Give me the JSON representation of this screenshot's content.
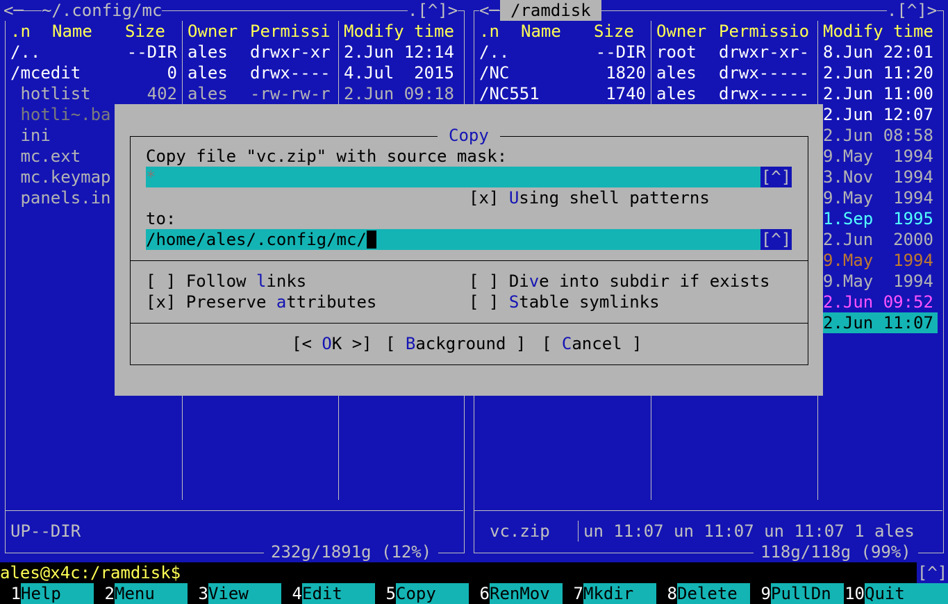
{
  "left_panel": {
    "title": "~/.config/mc",
    "corner_left": "<",
    "corner_right": ".[^]>",
    "headers": [
      ".n",
      "Name",
      "Size",
      "Owner",
      "Permissi",
      "Modify time"
    ],
    "rows": [
      {
        "name": "/..",
        "size": "--DIR",
        "owner": "ales",
        "perm": "drwxr-xr",
        "time": "2.Jun 12:14"
      },
      {
        "name": "/mcedit",
        "size": "0",
        "owner": "ales",
        "perm": "drwx----",
        "time": "4.Jul  2015"
      },
      {
        "name": " hotlist",
        "size": "402",
        "owner": "ales",
        "perm": "-rw-rw-r",
        "time": "2.Jun 09:18"
      },
      {
        "name": " hotli~.ba"
      },
      {
        "name": " ini"
      },
      {
        "name": " mc.ext"
      },
      {
        "name": " mc.keymap"
      },
      {
        "name": " panels.in"
      }
    ],
    "status": "UP--DIR",
    "disk": "232g/1891g (12%)"
  },
  "right_panel": {
    "title": "/ramdisk",
    "corner_left": "<",
    "corner_right": ".[^]>",
    "headers": [
      ".n",
      "Name",
      "Size",
      "Owner",
      "Permissio",
      "Modify time"
    ],
    "rows": [
      {
        "name": "/..",
        "size": "--DIR",
        "owner": "root",
        "perm": "drwxr-xr-",
        "time": "8.Jun 22:01"
      },
      {
        "name": "/NC",
        "size": "1820",
        "owner": "ales",
        "perm": "drwx-----",
        "time": "2.Jun 11:20"
      },
      {
        "name": "/NC551",
        "size": "1740",
        "owner": "ales",
        "perm": "drwx-----",
        "time": "2.Jun 11:00"
      }
    ],
    "times": [
      "2.Jun 12:07",
      "2.Jun 08:58",
      "9.May  1994",
      "3.Nov  1994",
      "9.May  1994",
      "1.Sep  1995",
      "2.Jun  2000",
      "9.May  1994",
      "9.May  1994",
      "2.Jun 09:52",
      "2.Jun 11:07"
    ],
    "status_name": "vc.zip",
    "status_info": "un 11:07 un 11:07 un 11:07 1 ales",
    "disk": "118g/118g (99%)"
  },
  "dialog": {
    "title": "Copy",
    "source_label": "Copy file \"vc.zip\" with source mask:",
    "source_value": "*",
    "history_btn": "[^]",
    "shell_patterns": {
      "box": "[x]",
      "hot": "U",
      "rest": "sing shell patterns"
    },
    "to_label": "to:",
    "to_value": "/home/ales/.config/mc/",
    "follow_links": {
      "box": "[ ]",
      "pre": "Follow ",
      "hot": "l",
      "rest": "inks"
    },
    "preserve": {
      "box": "[x]",
      "pre": "Preserve ",
      "hot": "a",
      "rest": "ttributes"
    },
    "dive": {
      "box": "[ ]",
      "pre": "Di",
      "hot": "v",
      "rest": "e into subdir if exists"
    },
    "stable": {
      "box": "[ ]",
      "pre": "",
      "hot": "S",
      "rest": "table symlinks"
    },
    "ok": {
      "pre": "[< ",
      "hot": "O",
      "rest": "K >]"
    },
    "background": {
      "pre": "[ ",
      "hot": "B",
      "rest": "ackground ]"
    },
    "cancel": {
      "pre": "[ ",
      "hot": "C",
      "rest": "ancel ]"
    }
  },
  "command_line": "ales@x4c:/ramdisk$",
  "command_corner": "[^]",
  "fkeys": [
    {
      "n": "1",
      "l": "Help"
    },
    {
      "n": "2",
      "l": "Menu"
    },
    {
      "n": "3",
      "l": "View"
    },
    {
      "n": "4",
      "l": "Edit"
    },
    {
      "n": "5",
      "l": "Copy"
    },
    {
      "n": "6",
      "l": "RenMov"
    },
    {
      "n": "7",
      "l": "Mkdir"
    },
    {
      "n": "8",
      "l": "Delete"
    },
    {
      "n": "9",
      "l": "PullDn"
    },
    {
      "n": "10",
      "l": "Quit"
    }
  ]
}
